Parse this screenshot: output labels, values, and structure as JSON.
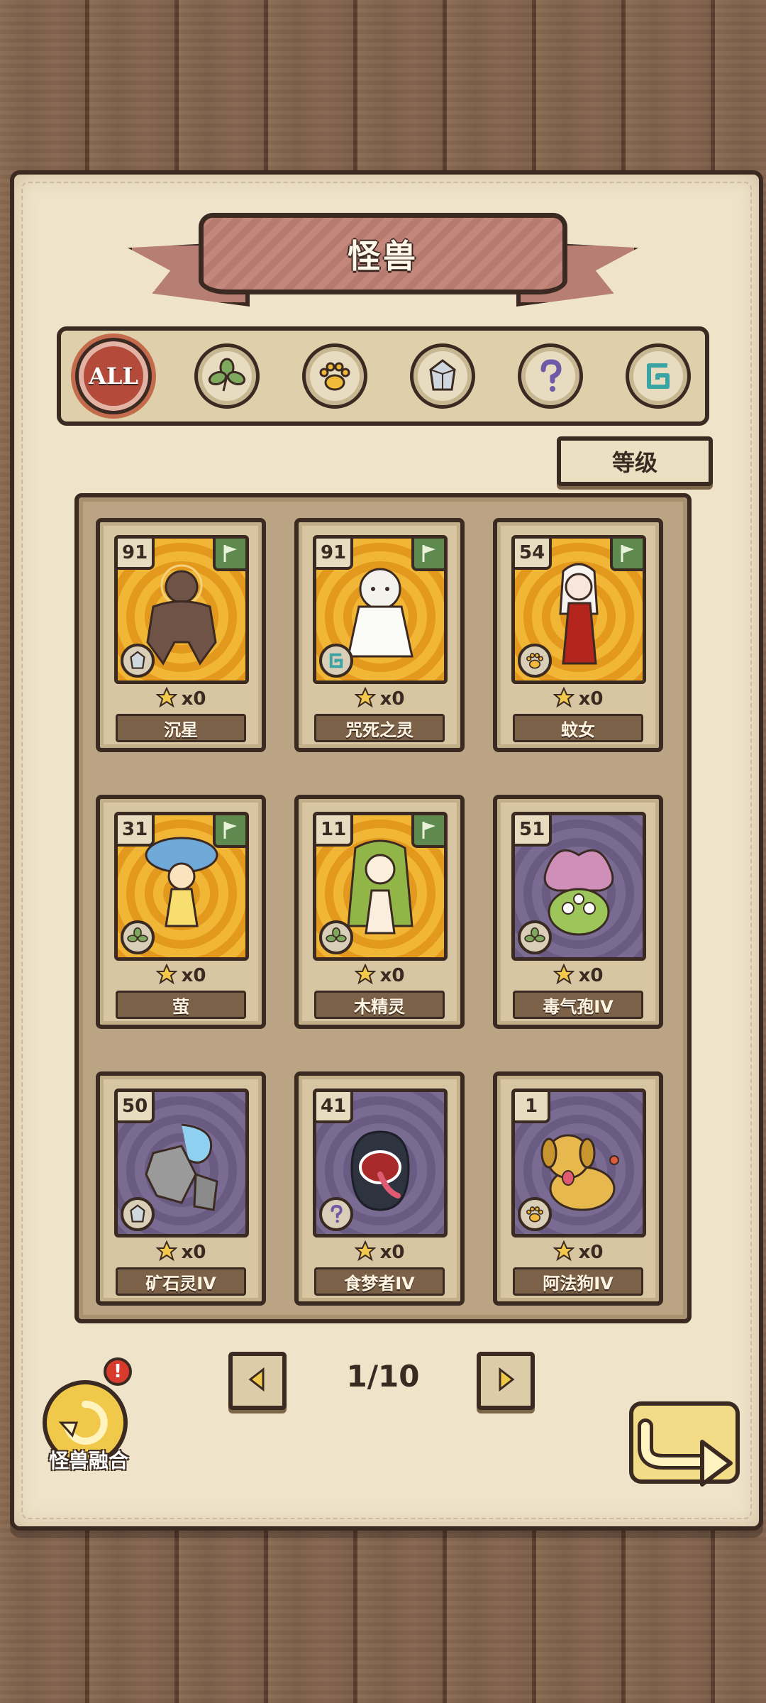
{
  "page": {
    "title": "怪兽"
  },
  "filters": [
    {
      "key": "all",
      "label": "ALL",
      "active": true,
      "icon": "all-icon"
    },
    {
      "key": "plant",
      "label": "",
      "active": false,
      "icon": "leaf-icon"
    },
    {
      "key": "beast",
      "label": "",
      "active": false,
      "icon": "paw-icon"
    },
    {
      "key": "mineral",
      "label": "",
      "active": false,
      "icon": "crystal-icon"
    },
    {
      "key": "unknown",
      "label": "",
      "active": false,
      "icon": "question-icon"
    },
    {
      "key": "spirit",
      "label": "",
      "active": false,
      "icon": "swirl-icon"
    }
  ],
  "sort": {
    "label": "等级"
  },
  "monsters": [
    {
      "level": "91",
      "name": "沉星",
      "count": "x0",
      "bg": "gold",
      "flag": true,
      "type_icon": "crystal-icon",
      "art_icon": "rock-golem-icon"
    },
    {
      "level": "91",
      "name": "咒死之灵",
      "count": "x0",
      "bg": "gold",
      "flag": true,
      "type_icon": "swirl-icon",
      "art_icon": "ghost-girl-icon"
    },
    {
      "level": "54",
      "name": "蚊女",
      "count": "x0",
      "bg": "gold",
      "flag": true,
      "type_icon": "paw-icon",
      "art_icon": "mosquito-girl-icon"
    },
    {
      "level": "31",
      "name": "萤",
      "count": "x0",
      "bg": "gold",
      "flag": true,
      "type_icon": "leaf-icon",
      "art_icon": "mushroom-girl-icon"
    },
    {
      "level": "11",
      "name": "木精灵",
      "count": "x0",
      "bg": "gold",
      "flag": true,
      "type_icon": "leaf-icon",
      "art_icon": "dryad-icon"
    },
    {
      "level": "51",
      "name": "毒气孢IV",
      "count": "x0",
      "bg": "purple",
      "flag": false,
      "type_icon": "leaf-icon",
      "art_icon": "spore-monster-icon"
    },
    {
      "level": "50",
      "name": "矿石灵IV",
      "count": "x0",
      "bg": "purple",
      "flag": false,
      "type_icon": "crystal-icon",
      "art_icon": "ore-spirit-icon"
    },
    {
      "level": "41",
      "name": "食梦者IV",
      "count": "x0",
      "bg": "purple",
      "flag": false,
      "type_icon": "question-icon",
      "art_icon": "dream-eater-icon"
    },
    {
      "level": "1",
      "name": "阿法狗IV",
      "count": "x0",
      "bg": "purple",
      "flag": false,
      "type_icon": "paw-icon",
      "art_icon": "dog-icon"
    }
  ],
  "pagination": {
    "current": "1/10",
    "prev_icon": "chevron-left-icon",
    "next_icon": "chevron-right-icon"
  },
  "fusion": {
    "label": "怪兽融合",
    "alert": "!"
  },
  "back": {
    "icon": "back-arrow-icon"
  },
  "colors": {
    "ink": "#3b2a22",
    "paper": "#efe3c9",
    "ribbon": "#c4877c",
    "gold_bg": "#f2b637",
    "purple_bg": "#7a6b93",
    "flag_green": "#5f8a4f",
    "active_red": "#b44a3a",
    "fusion_yellow": "#f0c94a"
  }
}
